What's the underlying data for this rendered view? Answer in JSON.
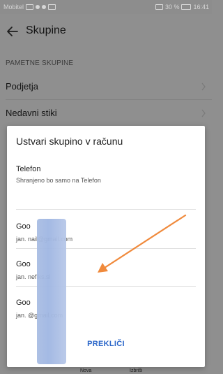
{
  "status_bar": {
    "carrier": "Mobitel",
    "right_text": "30 %",
    "time": "16:41"
  },
  "app_bar": {
    "title": "Skupine"
  },
  "background": {
    "section_header": "PAMETNE SKUPINE",
    "rows": [
      {
        "label": "Podjetja"
      },
      {
        "label": "Nedavni stiki"
      }
    ],
    "bottom_nav_label": "Nova",
    "bottom_nav_label_2": "Izbriši"
  },
  "dialog": {
    "title": "Ustvari skupino v računu",
    "options": [
      {
        "name": "Telefon",
        "subtitle": "Shranjeno bo samo na Telefon"
      },
      {
        "name": "Goo",
        "subtitle": "jan.            nail@gmail.com"
      },
      {
        "name": "Goo",
        "subtitle": "jan.            nefiks.si"
      },
      {
        "name": "Goo",
        "subtitle": "jan.            @gmail.com"
      }
    ],
    "cancel_label": "PREKLIČI"
  },
  "colors": {
    "accent": "#2a66c9",
    "arrow": "#f08a3c",
    "redaction": "#a9bde3"
  }
}
